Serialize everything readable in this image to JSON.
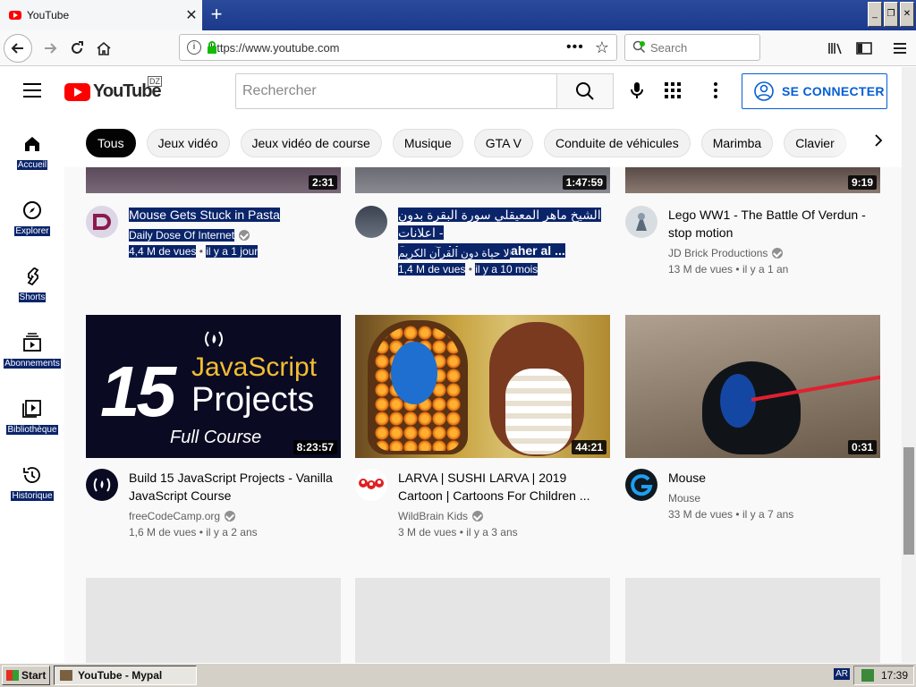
{
  "browser": {
    "tab_title": "YouTube",
    "url": "https://www.youtube.com",
    "search_placeholder": "Search"
  },
  "header": {
    "logo_text": "YouTube",
    "country_code": "DZ",
    "search_placeholder": "Rechercher",
    "signin_label": "SE CONNECTER"
  },
  "chips": [
    "Tous",
    "Jeux vidéo",
    "Jeux vidéo de course",
    "Musique",
    "GTA V",
    "Conduite de véhicules",
    "Marimba",
    "Clavier"
  ],
  "sidebar": {
    "items": [
      {
        "label": "Accueil",
        "icon": "home-icon"
      },
      {
        "label": "Explorer",
        "icon": "compass-icon"
      },
      {
        "label": "Shorts",
        "icon": "shorts-icon"
      },
      {
        "label": "Abonnements",
        "icon": "subscriptions-icon"
      },
      {
        "label": "Bibliothèque",
        "icon": "library-icon"
      },
      {
        "label": "Historique",
        "icon": "history-icon"
      }
    ]
  },
  "videos_row1": [
    {
      "duration": "2:31",
      "title": "Mouse Gets Stuck in Pasta",
      "channel": "Daily Dose Of Internet",
      "views": "4,4 M de vues",
      "age": "il y a 1 jour"
    },
    {
      "duration": "1:47:59",
      "title_line1": "الشيخ ماهر المعيقلي سورة البقرة بدون اعلانات -",
      "title_line2": "Sourat al baqara maher al ...",
      "channel": "لا حياة دون القرآن الكريم",
      "views": "1,4 M de vues",
      "age": "il y a 10 mois"
    },
    {
      "duration": "9:19",
      "title": "Lego WW1 - The Battle Of Verdun - stop motion",
      "channel": "JD Brick Productions",
      "views": "13 M de vues",
      "age": "il y a 1 an"
    }
  ],
  "videos_row2": [
    {
      "duration": "8:23:57",
      "thumb_number": "15",
      "thumb_line1": "JavaScript",
      "thumb_line2": "Projects",
      "thumb_line3": "Full Course",
      "title": "Build 15 JavaScript Projects - Vanilla JavaScript Course",
      "channel": "freeCodeCamp.org",
      "views": "1,6 M de vues",
      "age": "il y a 2 ans"
    },
    {
      "duration": "44:21",
      "title": "LARVA | SUSHI LARVA | 2019 Cartoon | Cartoons For Children ...",
      "channel": "WildBrain Kids",
      "views": "3 M de vues",
      "age": "il y a 3 ans"
    },
    {
      "duration": "0:31",
      "title": "Mouse",
      "channel": "Mouse",
      "views": "33 M de vues",
      "age": "il y a 7 ans"
    }
  ],
  "meta_separator": "•",
  "taskbar": {
    "start_label": "Start",
    "task_label": "YouTube - Mypal",
    "lang": "AR",
    "clock": "17:39"
  },
  "colors": {
    "brand_red": "#ff0000",
    "link_blue": "#065fd4",
    "selection": "#0a246a"
  }
}
